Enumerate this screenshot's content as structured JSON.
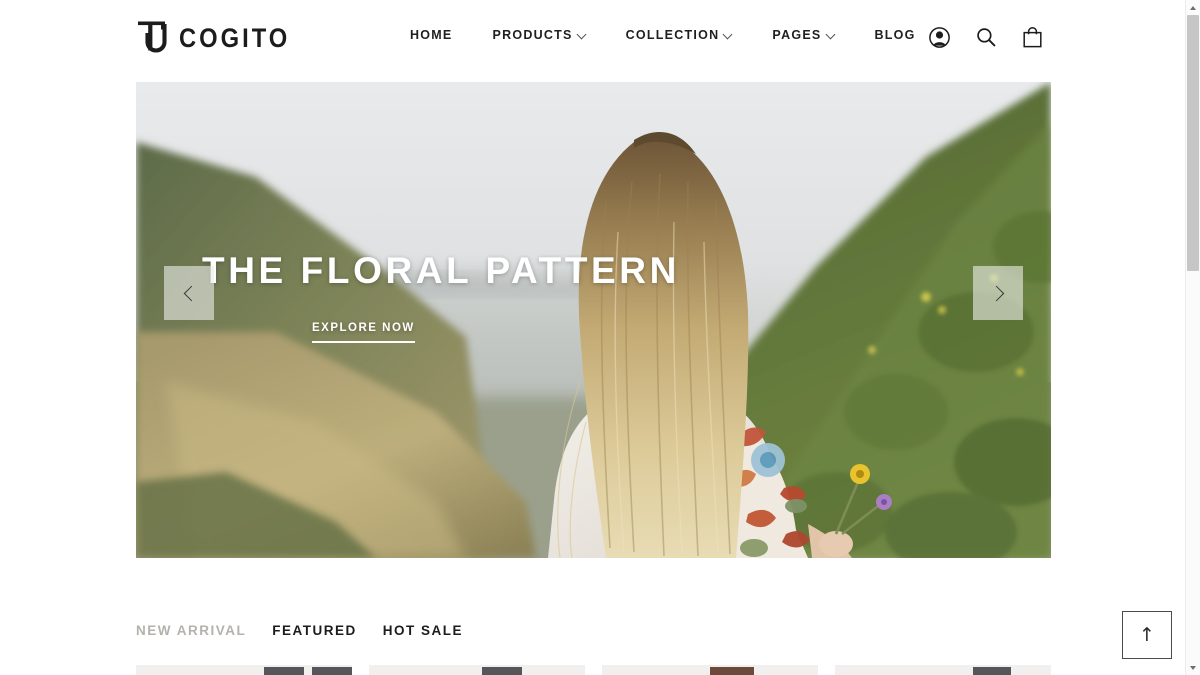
{
  "header": {
    "logo": {
      "mark_icon": "tc-monogram-icon",
      "text": "COGITO"
    },
    "nav": [
      {
        "label": "HOME",
        "has_caret": false
      },
      {
        "label": "PRODUCTS",
        "has_caret": true
      },
      {
        "label": "COLLECTION",
        "has_caret": true
      },
      {
        "label": "PAGES",
        "has_caret": true
      },
      {
        "label": "BLOG",
        "has_caret": false
      }
    ],
    "icons": [
      {
        "name": "account-icon"
      },
      {
        "name": "search-icon"
      },
      {
        "name": "shopping-bag-icon"
      }
    ]
  },
  "hero": {
    "title": "THE FLORAL PATTERN",
    "cta_label": "EXPLORE NOW",
    "prev_icon": "chevron-left-icon",
    "next_icon": "chevron-right-icon",
    "image_alt": "Woman with long blonde hair in floral-sleeved top holding wildflowers on a green coastal hillside"
  },
  "filters": {
    "tabs": [
      {
        "label": "NEW ARRIVAL",
        "active": false
      },
      {
        "label": "FEATURED",
        "active": true
      },
      {
        "label": "HOT SALE",
        "active": true
      }
    ]
  },
  "products": [
    {
      "name": "product-card-1"
    },
    {
      "name": "product-card-2"
    },
    {
      "name": "product-card-3"
    },
    {
      "name": "product-card-4"
    }
  ],
  "scroll_top": {
    "icon": "arrow-up-icon",
    "glyph": "↑"
  },
  "scrollbar": {
    "up_icon": "scroll-up-arrow-icon",
    "down_icon": "scroll-down-arrow-icon"
  },
  "colors": {
    "page_bg": "#ffffff",
    "text": "#1c1c1c",
    "muted_text": "#b5b2ae",
    "card_bg": "#f2f0ee",
    "swatch": "#55565a",
    "scrollbar_thumb": "#c6c6c6"
  }
}
